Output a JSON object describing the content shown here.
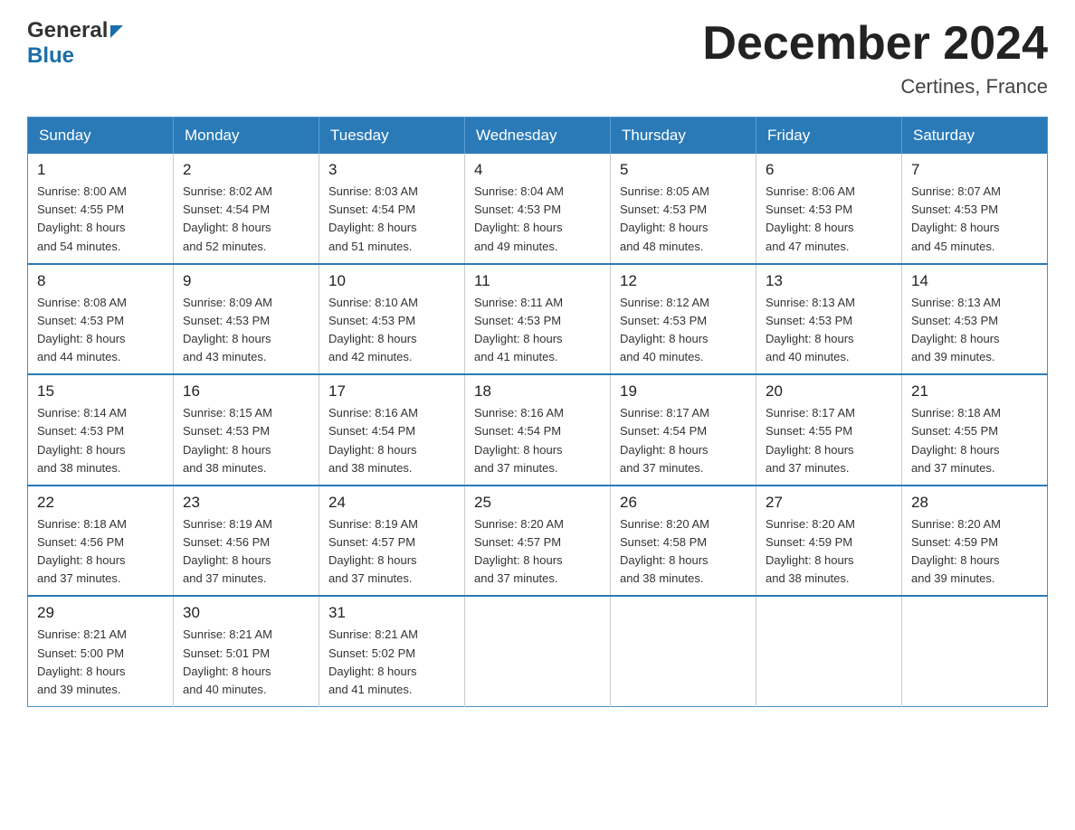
{
  "header": {
    "logo_general": "General",
    "logo_blue": "Blue",
    "main_title": "December 2024",
    "subtitle": "Certines, France"
  },
  "calendar": {
    "days_of_week": [
      "Sunday",
      "Monday",
      "Tuesday",
      "Wednesday",
      "Thursday",
      "Friday",
      "Saturday"
    ],
    "weeks": [
      [
        {
          "day": "1",
          "sunrise": "8:00 AM",
          "sunset": "4:55 PM",
          "daylight": "8 hours and 54 minutes."
        },
        {
          "day": "2",
          "sunrise": "8:02 AM",
          "sunset": "4:54 PM",
          "daylight": "8 hours and 52 minutes."
        },
        {
          "day": "3",
          "sunrise": "8:03 AM",
          "sunset": "4:54 PM",
          "daylight": "8 hours and 51 minutes."
        },
        {
          "day": "4",
          "sunrise": "8:04 AM",
          "sunset": "4:53 PM",
          "daylight": "8 hours and 49 minutes."
        },
        {
          "day": "5",
          "sunrise": "8:05 AM",
          "sunset": "4:53 PM",
          "daylight": "8 hours and 48 minutes."
        },
        {
          "day": "6",
          "sunrise": "8:06 AM",
          "sunset": "4:53 PM",
          "daylight": "8 hours and 47 minutes."
        },
        {
          "day": "7",
          "sunrise": "8:07 AM",
          "sunset": "4:53 PM",
          "daylight": "8 hours and 45 minutes."
        }
      ],
      [
        {
          "day": "8",
          "sunrise": "8:08 AM",
          "sunset": "4:53 PM",
          "daylight": "8 hours and 44 minutes."
        },
        {
          "day": "9",
          "sunrise": "8:09 AM",
          "sunset": "4:53 PM",
          "daylight": "8 hours and 43 minutes."
        },
        {
          "day": "10",
          "sunrise": "8:10 AM",
          "sunset": "4:53 PM",
          "daylight": "8 hours and 42 minutes."
        },
        {
          "day": "11",
          "sunrise": "8:11 AM",
          "sunset": "4:53 PM",
          "daylight": "8 hours and 41 minutes."
        },
        {
          "day": "12",
          "sunrise": "8:12 AM",
          "sunset": "4:53 PM",
          "daylight": "8 hours and 40 minutes."
        },
        {
          "day": "13",
          "sunrise": "8:13 AM",
          "sunset": "4:53 PM",
          "daylight": "8 hours and 40 minutes."
        },
        {
          "day": "14",
          "sunrise": "8:13 AM",
          "sunset": "4:53 PM",
          "daylight": "8 hours and 39 minutes."
        }
      ],
      [
        {
          "day": "15",
          "sunrise": "8:14 AM",
          "sunset": "4:53 PM",
          "daylight": "8 hours and 38 minutes."
        },
        {
          "day": "16",
          "sunrise": "8:15 AM",
          "sunset": "4:53 PM",
          "daylight": "8 hours and 38 minutes."
        },
        {
          "day": "17",
          "sunrise": "8:16 AM",
          "sunset": "4:54 PM",
          "daylight": "8 hours and 38 minutes."
        },
        {
          "day": "18",
          "sunrise": "8:16 AM",
          "sunset": "4:54 PM",
          "daylight": "8 hours and 37 minutes."
        },
        {
          "day": "19",
          "sunrise": "8:17 AM",
          "sunset": "4:54 PM",
          "daylight": "8 hours and 37 minutes."
        },
        {
          "day": "20",
          "sunrise": "8:17 AM",
          "sunset": "4:55 PM",
          "daylight": "8 hours and 37 minutes."
        },
        {
          "day": "21",
          "sunrise": "8:18 AM",
          "sunset": "4:55 PM",
          "daylight": "8 hours and 37 minutes."
        }
      ],
      [
        {
          "day": "22",
          "sunrise": "8:18 AM",
          "sunset": "4:56 PM",
          "daylight": "8 hours and 37 minutes."
        },
        {
          "day": "23",
          "sunrise": "8:19 AM",
          "sunset": "4:56 PM",
          "daylight": "8 hours and 37 minutes."
        },
        {
          "day": "24",
          "sunrise": "8:19 AM",
          "sunset": "4:57 PM",
          "daylight": "8 hours and 37 minutes."
        },
        {
          "day": "25",
          "sunrise": "8:20 AM",
          "sunset": "4:57 PM",
          "daylight": "8 hours and 37 minutes."
        },
        {
          "day": "26",
          "sunrise": "8:20 AM",
          "sunset": "4:58 PM",
          "daylight": "8 hours and 38 minutes."
        },
        {
          "day": "27",
          "sunrise": "8:20 AM",
          "sunset": "4:59 PM",
          "daylight": "8 hours and 38 minutes."
        },
        {
          "day": "28",
          "sunrise": "8:20 AM",
          "sunset": "4:59 PM",
          "daylight": "8 hours and 39 minutes."
        }
      ],
      [
        {
          "day": "29",
          "sunrise": "8:21 AM",
          "sunset": "5:00 PM",
          "daylight": "8 hours and 39 minutes."
        },
        {
          "day": "30",
          "sunrise": "8:21 AM",
          "sunset": "5:01 PM",
          "daylight": "8 hours and 40 minutes."
        },
        {
          "day": "31",
          "sunrise": "8:21 AM",
          "sunset": "5:02 PM",
          "daylight": "8 hours and 41 minutes."
        },
        null,
        null,
        null,
        null
      ]
    ]
  }
}
